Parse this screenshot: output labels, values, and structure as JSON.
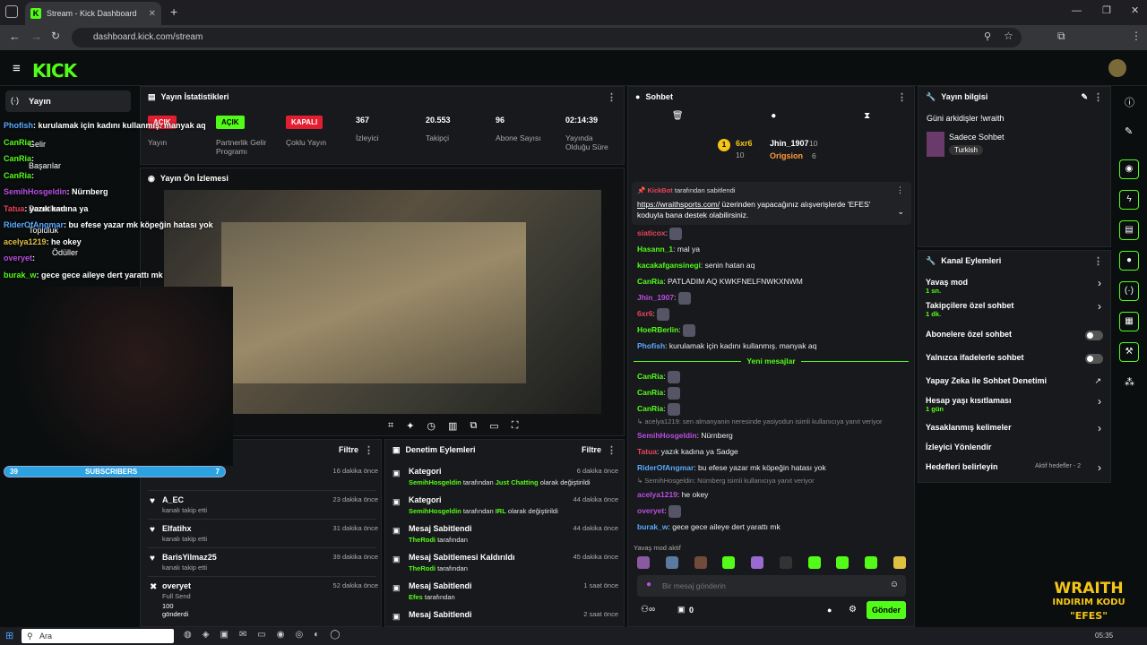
{
  "browser": {
    "tab_title": "Stream - Kick Dashboard",
    "url": "dashboard.kick.com/stream"
  },
  "nav": {
    "items": [
      {
        "label": "Yayın"
      },
      {
        "label": "Gelir"
      },
      {
        "label": "Başarılar"
      },
      {
        "label": "Denetleme"
      },
      {
        "label": "Topluluk"
      },
      {
        "label": "Ödüller"
      }
    ]
  },
  "stats": {
    "title": "Yayın İstatistikleri",
    "items": [
      {
        "value": "AÇIK",
        "label": "Yayın"
      },
      {
        "value": "AÇIK",
        "label": "Partnerlik Gelir Programı"
      },
      {
        "value": "KAPALI",
        "label": "Çoklu Yayın"
      },
      {
        "value": "367",
        "label": "İzleyici"
      },
      {
        "value": "20.553",
        "label": "Takipçi"
      },
      {
        "value": "96",
        "label": "Abone Sayısı"
      },
      {
        "value": "02:14:39",
        "label": "Yayında Olduğu Süre"
      }
    ]
  },
  "preview": {
    "title": "Yayın Ön İzlemesi"
  },
  "overlay": {
    "subs_left": "39",
    "subs_label": "SUBSCRIBERS",
    "subs_right": "7",
    "lines": [
      {
        "user": "Phofish",
        "text": ": kurulamak için kadını kullanmış. manyak aq"
      },
      {
        "user": "CanRia",
        "text": ":"
      },
      {
        "user": "CanRia",
        "text": ":"
      },
      {
        "user": "CanRia",
        "text": ":"
      },
      {
        "user": "SemihHosgeldin",
        "text": ": Nürnberg"
      },
      {
        "user": "Tatua",
        "text": ": yazık kadına ya"
      },
      {
        "user": "RiderOfAngmar",
        "text": ": bu efese yazar mk köpeğin hatası yok"
      },
      {
        "user": "acelya1219",
        "text": ": he okey"
      },
      {
        "user": "overyet",
        "text": ":"
      },
      {
        "user": "burak_w",
        "text": ": gece gece aileye dert yarattı mk"
      }
    ]
  },
  "activity": {
    "filter": "Filtre",
    "items": [
      {
        "name": "",
        "desc": "kanalı takip etti",
        "time": "16 dakika önce"
      },
      {
        "name": "A_EC",
        "desc": "kanalı takip etti",
        "time": "23 dakika önce"
      },
      {
        "name": "Elfatihx",
        "desc": "kanalı takip etti",
        "time": "31 dakika önce"
      },
      {
        "name": "BarisYilmaz25",
        "desc": "kanalı takip etti",
        "time": "39 dakika önce"
      },
      {
        "name": "overyet",
        "desc": "Full Send",
        "extra": "100",
        "extra2": "gönderdi",
        "time": "52 dakika önce"
      }
    ]
  },
  "moderation": {
    "title": "Denetim Eylemleri",
    "filter": "Filtre",
    "items": [
      {
        "title": "Kategori",
        "user": "SemihHosgeldin",
        "mid": " tarafından ",
        "hl": "Just Chatting",
        "tail": " olarak değiştirildi",
        "time": "6 dakika önce"
      },
      {
        "title": "Kategori",
        "user": "SemihHosgeldin",
        "mid": " tarafından ",
        "hl": "IRL",
        "tail": " olarak değiştirildi",
        "time": "44 dakika önce"
      },
      {
        "title": "Mesaj Sabitlendi",
        "user": "TheRodi",
        "mid": " tarafından",
        "hl": "",
        "tail": "",
        "time": "44 dakika önce"
      },
      {
        "title": "Mesaj Sabitlemesi Kaldırıldı",
        "user": "TheRodi",
        "mid": " tarafından",
        "hl": "",
        "tail": "",
        "time": "45 dakika önce"
      },
      {
        "title": "Mesaj Sabitlendi",
        "user": "Efes",
        "mid": " tarafından",
        "hl": "",
        "tail": "",
        "time": "1 saat önce"
      },
      {
        "title": "Mesaj Sabitlendi",
        "user": "",
        "mid": "",
        "hl": "",
        "tail": "",
        "time": "2 saat önce"
      }
    ]
  },
  "chat": {
    "title": "Sohbet",
    "lb": [
      {
        "name": "6xr6",
        "n": "10"
      },
      {
        "name": "Jhin_1907",
        "n": "10"
      },
      {
        "name": "Origsion",
        "n": "6"
      }
    ],
    "pinned_by": "KickBot",
    "pinned_suffix": " tarafından sabitlendi",
    "pinned_link": "https://wraithsports.com/",
    "pinned_text": " üzerinden yapacağınız alışverişlerde 'EFES' koduyla bana destek olabilirsiniz.",
    "messages": [
      {
        "user": "siaticox",
        "text": ":",
        "c": "#e8455c"
      },
      {
        "user": "Hasann_1",
        "text": ": mal ya",
        "c": "#53fc18"
      },
      {
        "user": "kacakafgansinegi",
        "text": ": senin hatan aq",
        "c": "#53fc18"
      },
      {
        "user": "CanRia",
        "text": ": PATLADIM AQ KWKFNELFNWKXNWM",
        "c": "#53fc18"
      },
      {
        "user": "Jhin_1907",
        "text": ":",
        "c": "#b84ee0"
      },
      {
        "user": "6xr6",
        "text": ":",
        "c": "#e8455c"
      },
      {
        "user": "HoeRBerlin",
        "text": ":",
        "c": "#53fc18"
      },
      {
        "user": "Phofish",
        "text": ": kurulamak için kadını kullanmış. manyak aq",
        "c": "#5aa9ff"
      }
    ],
    "new_label": "Yeni mesajlar",
    "messages2": [
      {
        "user": "CanRia",
        "text": ":",
        "c": "#53fc18"
      },
      {
        "user": "CanRia",
        "text": ":",
        "c": "#53fc18"
      },
      {
        "user": "CanRia",
        "text": ":",
        "c": "#53fc18"
      },
      {
        "reply": "acelya1219: sen almanyanin neresinde yasiyodun isimli kullanıcıya yanıt veriyor"
      },
      {
        "user": "SemihHosgeldin",
        "text": ": Nürnberg",
        "c": "#b84ee0"
      },
      {
        "user": "Tatua",
        "text": ": yazık kadına ya Sadge",
        "c": "#e8455c"
      },
      {
        "user": "RiderOfAngmar",
        "text": ": bu efese yazar mk köpeğin hatası yok",
        "c": "#5aa9ff"
      },
      {
        "reply": "SemihHosgeldin: Nürnberg isimli kullanıcıya yanıt veriyor"
      },
      {
        "user": "acelya1219",
        "text": ": he okey",
        "c": "#b84ee0"
      },
      {
        "user": "overyet",
        "text": ":",
        "c": "#b84ee0"
      },
      {
        "user": "burak_w",
        "text": ": gece gece aileye dert yarattı mk",
        "c": "#5aa9ff"
      }
    ],
    "slow_mode": "Yavaş mod aktif",
    "placeholder": "Bir mesaj gönderin",
    "points": "0",
    "send": "Gönder"
  },
  "info": {
    "title": "Yayın bilgisi",
    "stream_title": "Güni arkidişler !wraith",
    "category": "Sadece Sohbet",
    "tag": "Turkish"
  },
  "channel_actions": {
    "title": "Kanal Eylemleri",
    "items": [
      {
        "label": "Yavaş mod",
        "sub": "1 sn."
      },
      {
        "label": "Takipçilere özel sohbet",
        "sub": "1 dk."
      },
      {
        "label": "Abonelere özel sohbet",
        "sub": ""
      },
      {
        "label": "Yalnızca ifadelerle sohbet",
        "sub": ""
      },
      {
        "label": "Yapay Zeka ile Sohbet Denetimi",
        "sub": ""
      },
      {
        "label": "Hesap yaşı kısıtlaması",
        "sub": "1 gün"
      },
      {
        "label": "Yasaklanmış kelimeler",
        "sub": ""
      },
      {
        "label": "İzleyici Yönlendir",
        "sub": ""
      },
      {
        "label": "Hedefleri belirleyin",
        "sub": "Aktif hedefler - 2"
      }
    ]
  },
  "wraith": {
    "line1": "WRAITH",
    "line2": "INDIRIM KODU",
    "line3": "\"EFES\""
  },
  "taskbar": {
    "search": "Ara",
    "time": "05:35"
  },
  "colors": {
    "accent": "#53fc18",
    "red": "#e41e31"
  }
}
